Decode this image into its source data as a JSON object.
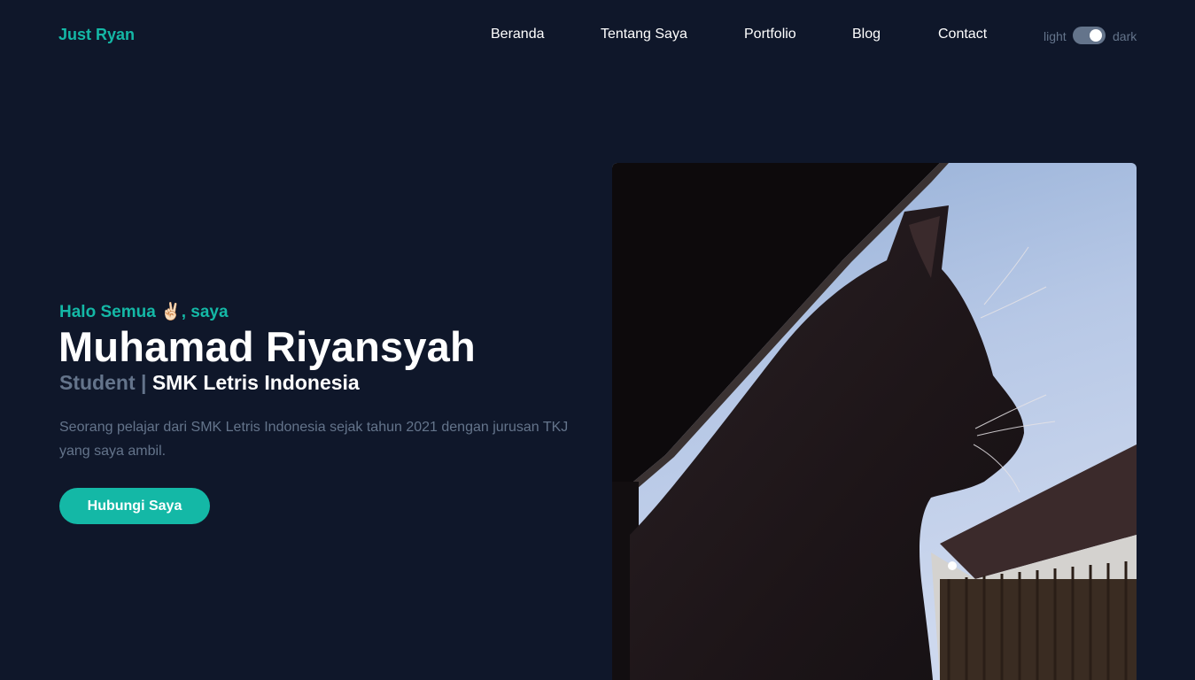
{
  "navbar": {
    "brand": "Just Ryan",
    "items": [
      {
        "label": "Beranda"
      },
      {
        "label": "Tentang Saya"
      },
      {
        "label": "Portfolio"
      },
      {
        "label": "Blog"
      },
      {
        "label": "Contact"
      }
    ],
    "theme_toggle": {
      "light_label": "light",
      "dark_label": "dark",
      "state": "dark"
    }
  },
  "hero": {
    "greeting_prefix": "Halo Semua ",
    "greeting_emoji": "✌🏻",
    "greeting_suffix": ", saya",
    "name": "Muhamad Riyansyah",
    "role": "Student | ",
    "school": "SMK Letris Indonesia",
    "description": "Seorang pelajar dari SMK Letris Indonesia sejak tahun 2021 dengan jurusan TKJ yang saya ambil.",
    "cta_label": "Hubungi Saya",
    "photo": {
      "subject": "cat-silhouette-photo"
    }
  },
  "colors": {
    "background": "#0f172a",
    "accent": "#14b8a6",
    "muted": "#64748b",
    "text": "#ffffff"
  }
}
